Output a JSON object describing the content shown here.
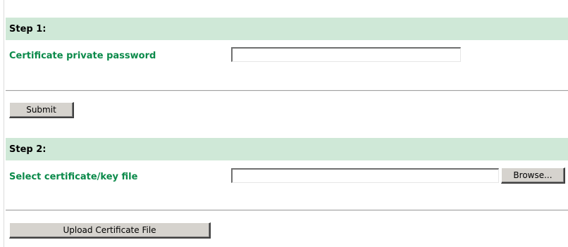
{
  "step1": {
    "title": "Step 1:",
    "password_label": "Certificate private password",
    "password_value": "",
    "submit_label": "Submit"
  },
  "step2": {
    "title": "Step 2:",
    "file_label": "Select certificate/key file",
    "file_value": "",
    "browse_label": "Browse...",
    "upload_label": "Upload Certificate File"
  },
  "colors": {
    "step_bar_bg": "#cfe8d7",
    "label_green": "#0b8a4a",
    "button_face": "#d6d3ce"
  }
}
